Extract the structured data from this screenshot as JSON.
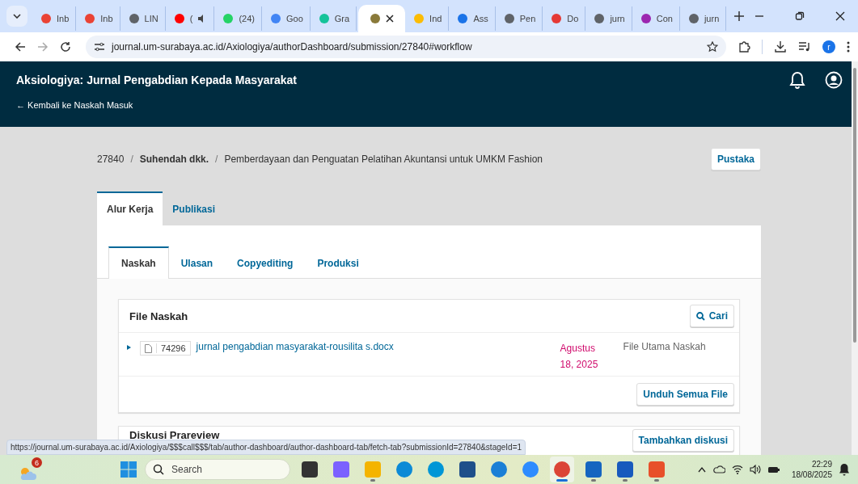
{
  "browser": {
    "tabs": [
      {
        "label": "Inb",
        "kind": "gmail",
        "selected": false,
        "audio": false
      },
      {
        "label": "Inb",
        "kind": "gmail",
        "selected": false,
        "audio": false
      },
      {
        "label": "LIN",
        "kind": "globe",
        "selected": false,
        "audio": false
      },
      {
        "label": "(",
        "kind": "youtube",
        "selected": false,
        "audio": true
      },
      {
        "label": "(24)",
        "kind": "whatsapp",
        "selected": false,
        "audio": false
      },
      {
        "label": "Goo",
        "kind": "translate",
        "selected": false,
        "audio": false
      },
      {
        "label": "Gra",
        "kind": "grammarly",
        "selected": false,
        "audio": false
      },
      {
        "kind": "emblem",
        "selected": true,
        "audio": false
      },
      {
        "label": "Ind",
        "kind": "drive",
        "selected": false,
        "audio": false
      },
      {
        "label": "Ass",
        "kind": "assign",
        "selected": false,
        "audio": false
      },
      {
        "label": "Pen",
        "kind": "globe",
        "selected": false,
        "audio": false
      },
      {
        "label": "Do",
        "kind": "heart",
        "selected": false,
        "audio": false
      },
      {
        "label": "jurn",
        "kind": "globe",
        "selected": false,
        "audio": false
      },
      {
        "label": "Con",
        "kind": "palette",
        "selected": false,
        "audio": false
      },
      {
        "label": "jurn",
        "kind": "globe",
        "selected": false,
        "audio": false
      }
    ],
    "url": "journal.um-surabaya.ac.id/Axiologiya/authorDashboard/submission/27840#workflow",
    "profile_initial": "r",
    "status_url": "https://journal.um-surabaya.ac.id/Axiologiya/$$$call$$$/tab/author-dashboard/author-dashboard-tab/fetch-tab?submissionId=27840&stageId=1"
  },
  "header": {
    "title": "Aksiologiya: Jurnal Pengabdian Kepada Masyarakat",
    "back_link": "← Kembali ke Naskah Masuk"
  },
  "breadcrumb": [
    {
      "text": "27840",
      "kind": "id"
    },
    {
      "text": "/",
      "kind": "sep"
    },
    {
      "text": "Suhendah dkk.",
      "kind": "author"
    },
    {
      "text": "/",
      "kind": "sep"
    },
    {
      "text": "Pemberdayaan dan Penguatan Pelatihan Akuntansi untuk UMKM Fashion",
      "kind": "title"
    }
  ],
  "library_button": "Pustaka",
  "main_tabs": [
    {
      "label": "Alur Kerja",
      "selected": true
    },
    {
      "label": "Publikasi",
      "selected": false
    }
  ],
  "stage_tabs": [
    {
      "label": "Naskah",
      "selected": true
    },
    {
      "label": "Ulasan",
      "selected": false
    },
    {
      "label": "Copyediting",
      "selected": false
    },
    {
      "label": "Produksi",
      "selected": false
    }
  ],
  "files": {
    "title": "File Naskah",
    "search_button": "Cari",
    "rows": [
      {
        "expanded": false,
        "id": "74296",
        "name": "jurnal pengabdian masyarakat-rousilita s.docx",
        "date": "Agustus 18, 2025",
        "type": "File Utama Naskah"
      }
    ],
    "download_button": "Unduh Semua File"
  },
  "discussions": {
    "title": "Diskusi Prareview",
    "add_button": "Tambahkan diskusi"
  },
  "taskbar": {
    "weather_badge": "6",
    "search_placeholder": "Search",
    "apps": [
      {
        "kind": "taskview",
        "selected": false,
        "running": false
      },
      {
        "kind": "copilot",
        "selected": false,
        "running": false
      },
      {
        "kind": "files",
        "selected": false,
        "running": true
      },
      {
        "kind": "edge",
        "selected": false,
        "running": false
      },
      {
        "kind": "hp",
        "selected": false,
        "running": false
      },
      {
        "kind": "store",
        "selected": false,
        "running": false
      },
      {
        "kind": "help",
        "selected": false,
        "running": false
      },
      {
        "kind": "zoom",
        "selected": false,
        "running": false
      },
      {
        "kind": "chrome",
        "selected": true,
        "running": true
      },
      {
        "kind": "mapp",
        "selected": false,
        "running": true
      },
      {
        "kind": "word",
        "selected": false,
        "running": true
      },
      {
        "kind": "pdf",
        "selected": false,
        "running": true
      }
    ],
    "time": "22:29",
    "date": "18/08/2025"
  }
}
